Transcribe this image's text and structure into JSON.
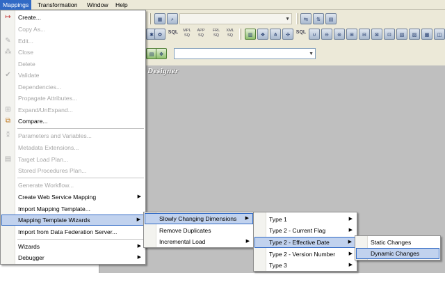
{
  "menubar": {
    "items": [
      "Mappings",
      "Transformation",
      "Window",
      "Help"
    ],
    "active": "Mappings"
  },
  "designer_label": "Designer",
  "toolbar": {
    "sql_buttons": [
      "MPL SQ",
      "APP SQ",
      "FRL SQ",
      "XML SQ"
    ],
    "sql_label": "SQL"
  },
  "mappings_menu": {
    "items": [
      {
        "label": "Create...",
        "enabled": true,
        "icon": "create-icon"
      },
      {
        "label": "Copy As...",
        "enabled": false
      },
      {
        "label": "Edit...",
        "enabled": false,
        "icon": "edit-icon"
      },
      {
        "label": "Close",
        "enabled": false,
        "icon": "close-icon"
      },
      {
        "label": "Delete",
        "enabled": false
      },
      {
        "label": "Validate",
        "enabled": false,
        "icon": "checkmark-icon"
      },
      {
        "label": "Dependencies...",
        "enabled": false
      },
      {
        "label": "Propagate Attributes...",
        "enabled": false
      },
      {
        "label": "Expand/UnExpand...",
        "enabled": false,
        "icon": "expand-icon"
      },
      {
        "label": "Compare...",
        "enabled": true,
        "icon": "compare-icon"
      },
      {
        "label": "Parameters and Variables...",
        "enabled": false,
        "icon": "parameters-icon"
      },
      {
        "label": "Metadata Extensions...",
        "enabled": false
      },
      {
        "label": "Target Load Plan...",
        "enabled": false,
        "icon": "target-load-icon"
      },
      {
        "label": "Stored Procedures Plan...",
        "enabled": false
      },
      {
        "label": "Generate Workflow...",
        "enabled": false
      },
      {
        "label": "Create Web Service Mapping",
        "enabled": true,
        "submenu": true
      },
      {
        "label": "Import Mapping Template...",
        "enabled": true
      },
      {
        "label": "Mapping Template Wizards",
        "enabled": true,
        "submenu": true,
        "highlighted": true
      },
      {
        "label": "Import from Data Federation Server...",
        "enabled": true
      },
      {
        "label": "Wizards",
        "enabled": true,
        "submenu": true
      },
      {
        "label": "Debugger",
        "enabled": true,
        "submenu": true
      }
    ]
  },
  "wizards_submenu": {
    "items": [
      {
        "label": "Slowly Changing Dimensions",
        "submenu": true,
        "highlighted": true
      },
      {
        "label": "Remove Duplicates",
        "submenu": false
      },
      {
        "label": "Incremental Load",
        "submenu": true
      }
    ]
  },
  "scd_submenu": {
    "items": [
      {
        "label": "Type 1",
        "submenu": true
      },
      {
        "label": "Type 2 - Current Flag",
        "submenu": true
      },
      {
        "label": "Type 2 - Effective Date",
        "submenu": true,
        "highlighted": true
      },
      {
        "label": "Type 2 - Version Number",
        "submenu": true
      },
      {
        "label": "Type 3",
        "submenu": true
      }
    ]
  },
  "effective_date_submenu": {
    "items": [
      {
        "label": "Static Changes",
        "highlighted": false
      },
      {
        "label": "Dynamic Changes",
        "highlighted": true
      }
    ]
  },
  "colors": {
    "menu_highlight": "#c1d2ee",
    "menu_highlight_border": "#316ac5",
    "menubar_active": "#316ac5",
    "canvas": "#bfbfbf",
    "chrome": "#ece9d8"
  }
}
